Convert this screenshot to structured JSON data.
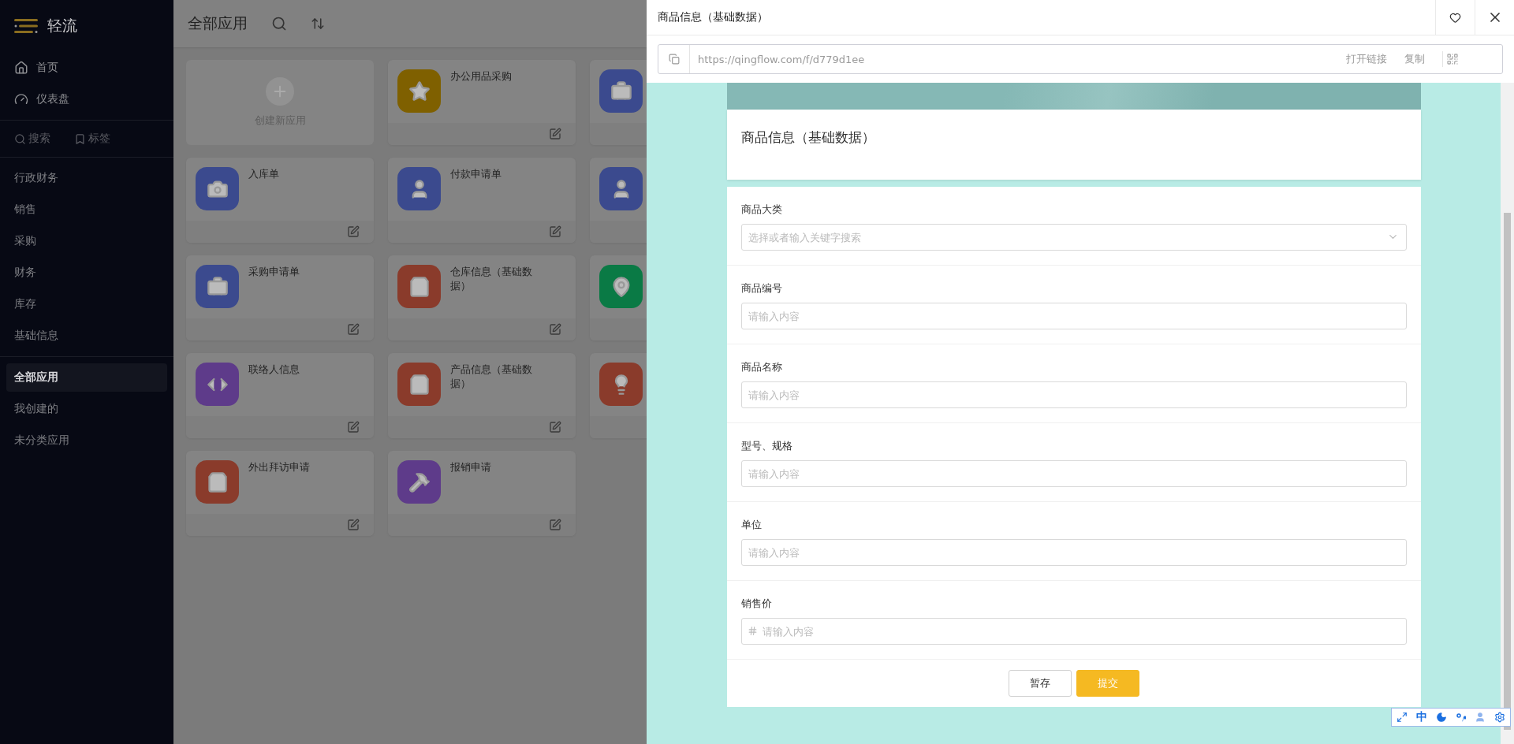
{
  "sidebar": {
    "logo": "轻流",
    "nav": [
      {
        "label": "首页",
        "kind": "home"
      },
      {
        "label": "仪表盘",
        "kind": "dashboard"
      }
    ],
    "tools": [
      {
        "label": "搜索",
        "kind": "search"
      },
      {
        "label": "标签",
        "kind": "tag"
      }
    ],
    "groups": [
      {
        "label": "行政财务",
        "selected": false
      },
      {
        "label": "销售",
        "selected": false
      },
      {
        "label": "采购",
        "selected": false
      },
      {
        "label": "财务",
        "selected": false
      },
      {
        "label": "库存",
        "selected": false
      },
      {
        "label": "基础信息",
        "selected": false
      }
    ],
    "views": [
      {
        "label": "全部应用",
        "selected": true
      },
      {
        "label": "我创建的",
        "selected": false
      },
      {
        "label": "未分类应用",
        "selected": false
      }
    ]
  },
  "main": {
    "title": "全部应用",
    "apps": [
      {
        "kind": "create",
        "name": "创建新应用"
      },
      {
        "kind": "app",
        "name": "办公用品采购",
        "color": "#7f6000"
      },
      {
        "kind": "app",
        "color": "#3b4a8e"
      },
      {
        "kind": "app",
        "name": "入库单",
        "color": "#3b4a8e"
      },
      {
        "kind": "app",
        "name": "付款申请单",
        "color": "#3b4a8e"
      },
      {
        "kind": "app",
        "color": "#3b4a8e"
      },
      {
        "kind": "app",
        "name": "采购申请单",
        "color": "#3b4a8e"
      },
      {
        "kind": "app",
        "name": "仓库信息（基础数据）",
        "color": "#8a3b2b"
      },
      {
        "kind": "app",
        "color": "#0a7a45"
      },
      {
        "kind": "app",
        "name": "联络人信息",
        "color": "#5e3b8a"
      },
      {
        "kind": "app",
        "name": "产品信息（基础数据）",
        "color": "#8a3b2b"
      },
      {
        "kind": "app",
        "color": "#8a3b2b"
      },
      {
        "kind": "app",
        "name": "外出拜访申请",
        "color": "#8a3b2b"
      },
      {
        "kind": "app",
        "name": "报销申请",
        "color": "#5e3b8a"
      }
    ]
  },
  "drawer": {
    "title": "商品信息（基础数据）",
    "url": "https://qingflow.com/f/d779d1ee",
    "open_link": "打开链接",
    "copy": "复制",
    "form": {
      "title": "商品信息（基础数据）",
      "fields": [
        {
          "label": "商品大类",
          "kind": "select",
          "placeholder": "选择或者输入关键字搜索"
        },
        {
          "label": "商品编号",
          "kind": "text",
          "placeholder": "请输入内容"
        },
        {
          "label": "商品名称",
          "kind": "text",
          "placeholder": "请输入内容"
        },
        {
          "label": "型号、规格",
          "kind": "text",
          "placeholder": "请输入内容"
        },
        {
          "label": "单位",
          "kind": "text",
          "placeholder": "请输入内容"
        },
        {
          "label": "销售价",
          "kind": "number",
          "placeholder": "请输入内容"
        }
      ],
      "buttons": [
        {
          "label": "暂存",
          "kind": "secondary"
        },
        {
          "label": "提交",
          "kind": "primary"
        }
      ]
    }
  },
  "ime_bar": {
    "mode": "中"
  }
}
